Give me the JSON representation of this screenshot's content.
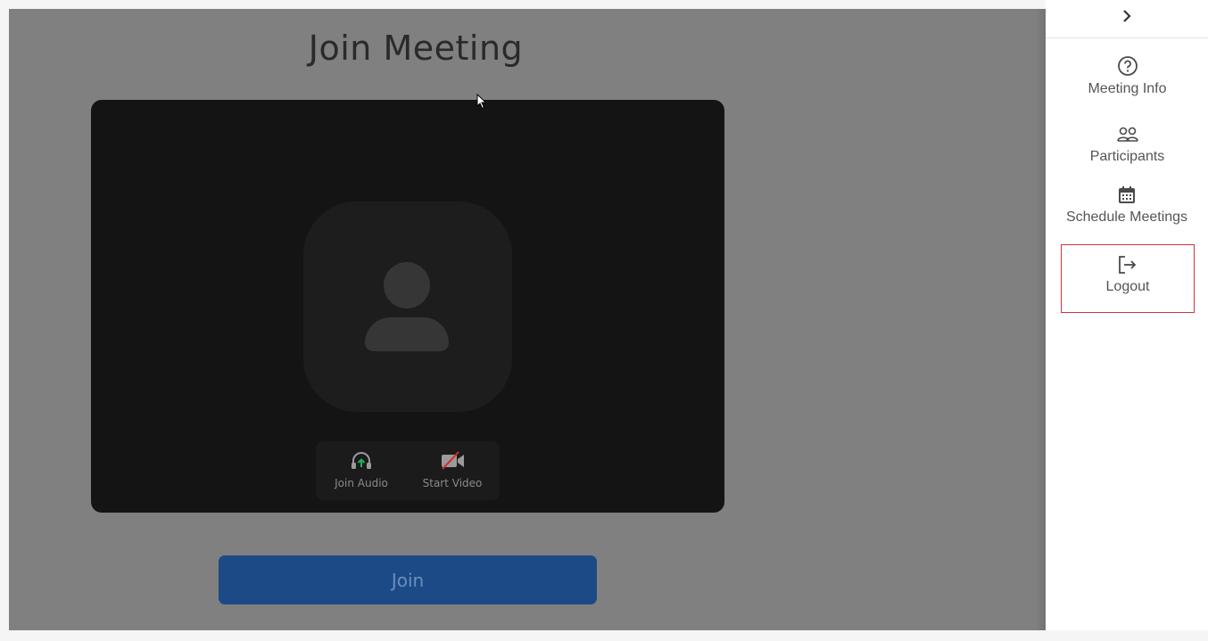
{
  "main": {
    "title": "Join Meeting",
    "controls": {
      "audio_label": "Join Audio",
      "video_label": "Start Video"
    },
    "join_label": "Join"
  },
  "sidebar": {
    "collapse_icon": "chevron-right-icon",
    "items": [
      {
        "label": "Meeting Info",
        "icon": "question-circle-icon"
      },
      {
        "label": "Participants",
        "icon": "participants-icon"
      },
      {
        "label": "Schedule Meetings",
        "icon": "calendar-icon"
      },
      {
        "label": "Logout",
        "icon": "logout-icon"
      }
    ]
  },
  "colors": {
    "overlay": "#808080",
    "preview_bg": "#141414",
    "join_button": "#1b4a86",
    "audio_arrow": "#1fb35a",
    "video_slash": "#d12c2c",
    "logout_border": "#d6303c"
  }
}
